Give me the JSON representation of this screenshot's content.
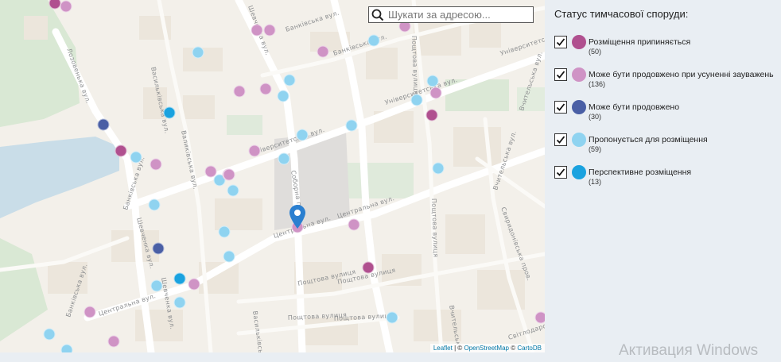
{
  "search": {
    "placeholder": "Шукати за адресою..."
  },
  "attribution": {
    "leaflet": "Leaflet",
    "sep1": " | © ",
    "osm": "OpenStreetMap",
    "sep2": " © ",
    "carto": "CartoDB"
  },
  "legend": {
    "title": "Статус тимчасової споруди:",
    "items": [
      {
        "label": "Розміщення припиняється",
        "count": "(50)",
        "color": "#b0508f",
        "checked": true
      },
      {
        "label": "Може бути продовжено при усуненні зауважень",
        "count": "(136)",
        "color": "#cf93c5",
        "checked": true
      },
      {
        "label": "Може бути продовжено",
        "count": "(30)",
        "color": "#4a5fa5",
        "checked": true
      },
      {
        "label": "Пропонується для розміщення",
        "count": "(59)",
        "color": "#8fd3f0",
        "checked": true
      },
      {
        "label": "Перспективне розміщення",
        "count": "(13)",
        "color": "#1aa2df",
        "checked": true
      }
    ]
  },
  "streets": [
    "Шевченка вул.",
    "Банківська вул.",
    "Банківська вул.",
    "Університетська вул.",
    "Університетська вул.",
    "Пощтова вулиця",
    "Лозовенька вул.",
    "Васильківська вул.",
    "Валиківська вул.",
    "Університетська вул.",
    "Соборна пл.",
    "Центральна вул.",
    "Центральна вул.",
    "Банківська вул.",
    "Пощтова вулиця",
    "Шевченка вул.",
    "Пощтова вулиця",
    "Пощтова вулиця",
    "Вчительська вул.",
    "Банківська вул.",
    "Центральна вул.",
    "Шевченка вул.",
    "Пощтова вулиця",
    "Пощтова вулиця",
    "Васильківська вул.",
    "Вчительська вул.",
    "Свиридонівська пров.",
    "Вчительська вул.",
    "Світлодарська пров."
  ],
  "markers": [
    {
      "cat": 0
    },
    {
      "cat": 1
    },
    {
      "cat": 1
    },
    {
      "cat": 3
    },
    {
      "cat": 1
    },
    {
      "cat": 1
    },
    {
      "cat": 3
    },
    {
      "cat": 1
    },
    {
      "cat": 1
    },
    {
      "cat": 1
    },
    {
      "cat": 3
    },
    {
      "cat": 3
    },
    {
      "cat": 3
    },
    {
      "cat": 3
    },
    {
      "cat": 1
    },
    {
      "cat": 4
    },
    {
      "cat": 2
    },
    {
      "cat": 3
    },
    {
      "cat": 3
    },
    {
      "cat": 0
    },
    {
      "cat": 3
    },
    {
      "cat": 3
    },
    {
      "cat": 1
    },
    {
      "cat": 1
    },
    {
      "cat": 1
    },
    {
      "cat": 3
    },
    {
      "cat": 3
    },
    {
      "cat": 3
    },
    {
      "cat": 1
    },
    {
      "cat": 0
    },
    {
      "cat": 2
    },
    {
      "cat": 3
    },
    {
      "cat": 4
    },
    {
      "cat": 1
    },
    {
      "cat": 3
    },
    {
      "cat": 0
    },
    {
      "cat": 3
    },
    {
      "cat": 3
    },
    {
      "cat": 1
    },
    {
      "cat": 1
    },
    {
      "cat": 3
    },
    {
      "cat": 3
    },
    {
      "cat": 1
    },
    {
      "cat": 1
    },
    {
      "cat": 3
    },
    {
      "cat": 1
    },
    {
      "cat": 0
    },
    {
      "cat": 3
    },
    {
      "cat": 1
    }
  ],
  "watermark": "Активация Windows"
}
